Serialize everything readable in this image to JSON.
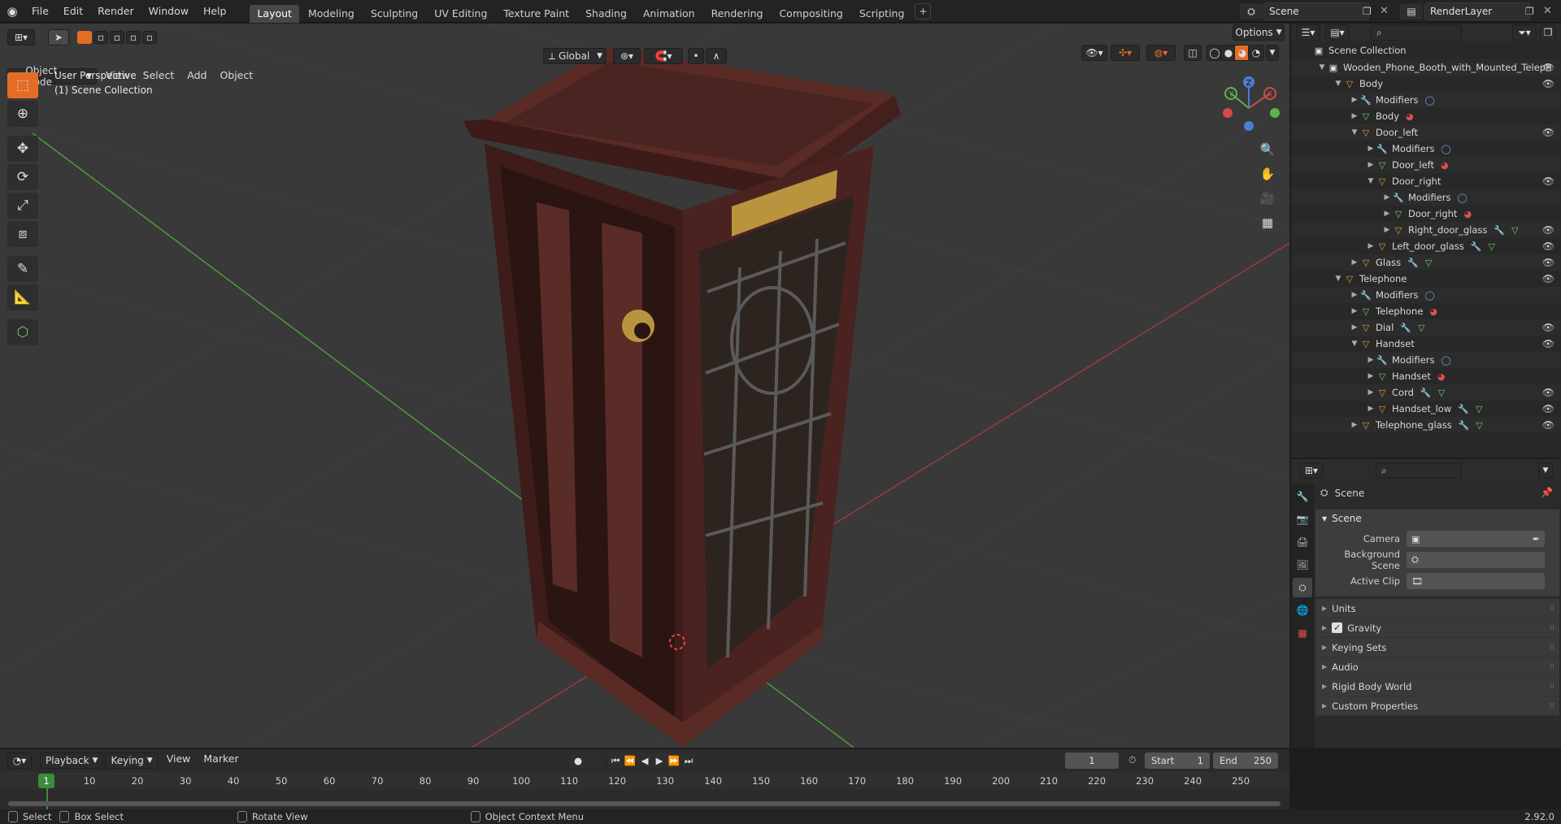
{
  "topbar": {
    "menus": [
      "File",
      "Edit",
      "Render",
      "Window",
      "Help"
    ],
    "workspaces": [
      "Layout",
      "Modeling",
      "Sculpting",
      "UV Editing",
      "Texture Paint",
      "Shading",
      "Animation",
      "Rendering",
      "Compositing",
      "Scripting"
    ],
    "active_workspace": "Layout",
    "plus": "+",
    "scene_name": "Scene",
    "render_layer": "RenderLayer"
  },
  "viewport": {
    "mode": "Object Mode",
    "menus": [
      "View",
      "Select",
      "Add",
      "Object"
    ],
    "orientation": "Global",
    "options_label": "Options",
    "info_line1": "User Perspective",
    "info_line2": "(1) Scene Collection",
    "gizmo_axes": [
      "X",
      "Y",
      "Z"
    ],
    "colors": {
      "bg": "#393939",
      "grid": "#404040",
      "x_axis": "#9b3b3b",
      "y_axis": "#4e9a3f",
      "wood": "#4f2420",
      "brass": "#b8943e"
    }
  },
  "outliner": {
    "root": "Scene Collection",
    "rows": [
      {
        "label": "Wooden_Phone_Booth_with_Mounted_Teleph",
        "depth": 1,
        "icon": "collection",
        "expanded": true,
        "eye": true
      },
      {
        "label": "Body",
        "depth": 2,
        "icon": "object",
        "expanded": true,
        "eye": true
      },
      {
        "label": "Modifiers",
        "depth": 3,
        "icon": "modifier",
        "expanded": false,
        "tags": [
          "modifier"
        ]
      },
      {
        "label": "Body",
        "depth": 3,
        "icon": "mesh",
        "expanded": false,
        "tags": [
          "material"
        ]
      },
      {
        "label": "Door_left",
        "depth": 3,
        "icon": "object",
        "expanded": true,
        "eye": true
      },
      {
        "label": "Modifiers",
        "depth": 4,
        "icon": "modifier",
        "expanded": false,
        "tags": [
          "modifier"
        ]
      },
      {
        "label": "Door_left",
        "depth": 4,
        "icon": "mesh",
        "expanded": false,
        "tags": [
          "material"
        ]
      },
      {
        "label": "Door_right",
        "depth": 4,
        "icon": "object",
        "expanded": true,
        "eye": true
      },
      {
        "label": "Modifiers",
        "depth": 5,
        "icon": "modifier",
        "expanded": false,
        "tags": [
          "modifier"
        ]
      },
      {
        "label": "Door_right",
        "depth": 5,
        "icon": "mesh",
        "expanded": false,
        "tags": [
          "material"
        ]
      },
      {
        "label": "Right_door_glass",
        "depth": 5,
        "icon": "object",
        "expanded": false,
        "eye": true,
        "tags": [
          "wrench",
          "mesh"
        ]
      },
      {
        "label": "Left_door_glass",
        "depth": 4,
        "icon": "object",
        "expanded": false,
        "eye": true,
        "tags": [
          "wrench",
          "mesh"
        ]
      },
      {
        "label": "Glass",
        "depth": 3,
        "icon": "object",
        "expanded": false,
        "eye": true,
        "tags": [
          "wrench",
          "mesh"
        ]
      },
      {
        "label": "Telephone",
        "depth": 2,
        "icon": "object",
        "expanded": true,
        "eye": true
      },
      {
        "label": "Modifiers",
        "depth": 3,
        "icon": "modifier",
        "expanded": false,
        "tags": [
          "modifier"
        ]
      },
      {
        "label": "Telephone",
        "depth": 3,
        "icon": "mesh",
        "expanded": false,
        "tags": [
          "material"
        ]
      },
      {
        "label": "Dial",
        "depth": 3,
        "icon": "object",
        "expanded": false,
        "eye": true,
        "tags": [
          "wrench",
          "mesh"
        ]
      },
      {
        "label": "Handset",
        "depth": 3,
        "icon": "object",
        "expanded": true,
        "eye": true
      },
      {
        "label": "Modifiers",
        "depth": 4,
        "icon": "modifier",
        "expanded": false,
        "tags": [
          "modifier"
        ]
      },
      {
        "label": "Handset",
        "depth": 4,
        "icon": "mesh",
        "expanded": false,
        "tags": [
          "material"
        ]
      },
      {
        "label": "Cord",
        "depth": 4,
        "icon": "object",
        "expanded": false,
        "eye": true,
        "tags": [
          "wrench",
          "mesh"
        ]
      },
      {
        "label": "Handset_low",
        "depth": 4,
        "icon": "object",
        "expanded": false,
        "eye": true,
        "tags": [
          "wrench",
          "mesh"
        ]
      },
      {
        "label": "Telephone_glass",
        "depth": 3,
        "icon": "object",
        "expanded": false,
        "eye": true,
        "tags": [
          "wrench",
          "mesh"
        ]
      }
    ]
  },
  "properties": {
    "context_title": "Scene",
    "panel_title": "Scene",
    "fields": [
      {
        "label": "Camera",
        "value": ""
      },
      {
        "label": "Background Scene",
        "value": ""
      },
      {
        "label": "Active Clip",
        "value": ""
      }
    ],
    "subpanels": [
      "Units",
      "Gravity",
      "Keying Sets",
      "Audio",
      "Rigid Body World",
      "Custom Properties"
    ],
    "gravity_checked": true
  },
  "timeline": {
    "menus": [
      "Playback",
      "Keying",
      "View",
      "Marker"
    ],
    "current_frame": "1",
    "start_label": "Start",
    "start": "1",
    "end_label": "End",
    "end": "250",
    "ticks": [
      "1",
      "10",
      "20",
      "30",
      "40",
      "50",
      "60",
      "70",
      "80",
      "90",
      "100",
      "110",
      "120",
      "130",
      "140",
      "150",
      "160",
      "170",
      "180",
      "190",
      "200",
      "210",
      "220",
      "230",
      "240",
      "250"
    ]
  },
  "statusbar": {
    "items": [
      "Select",
      "Box Select",
      "Rotate View",
      "Object Context Menu"
    ],
    "version": "2.92.0"
  }
}
